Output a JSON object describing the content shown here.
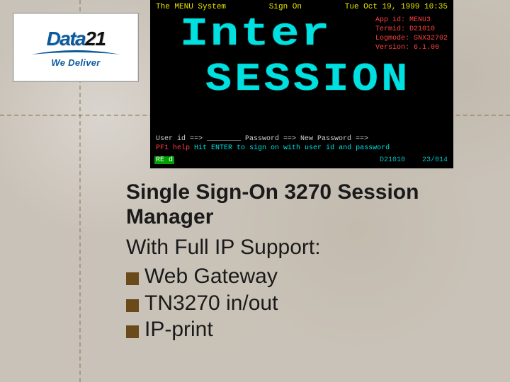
{
  "logo": {
    "brand_data": "Data",
    "brand_21": "21",
    "tagline": "We Deliver"
  },
  "terminal": {
    "header_left": "The MENU System",
    "header_center": "Sign On",
    "header_right": "Tue Oct 19, 1999 10:35",
    "big1": "Inter",
    "big2": "SESSION",
    "meta": {
      "app": "App id:  MENU3",
      "term": "Termid:  D21010",
      "logmode": "Logmode: SNX32702",
      "version": "Version: 6.1.00"
    },
    "bottom1": "User id ==> ________   Password ==>        New Password ==>",
    "bottom2_hint": "Hit ENTER to sign on with user id and password",
    "bottom2_key": "PF1 help",
    "cmd": "RE  d",
    "timestamp": "D21010",
    "cursor": "23/014"
  },
  "content": {
    "heading": "Single Sign-On 3270 Session Manager",
    "sub": "With Full IP Support:",
    "bullets": [
      "Web Gateway",
      "TN3270 in/out",
      "IP-print"
    ]
  }
}
